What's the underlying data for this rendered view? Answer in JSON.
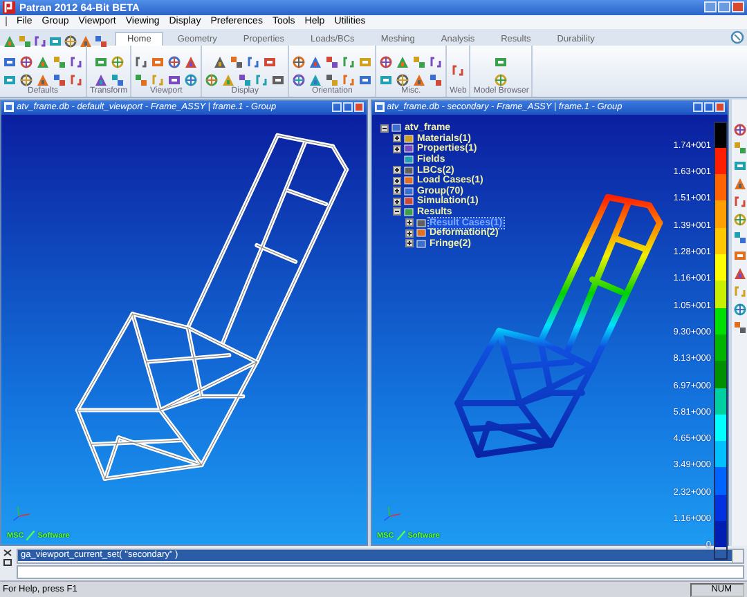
{
  "window": {
    "title": "Patran 2012 64-Bit BETA"
  },
  "menu": [
    "File",
    "Group",
    "Viewport",
    "Viewing",
    "Display",
    "Preferences",
    "Tools",
    "Help",
    "Utilities"
  ],
  "ribbon": {
    "tabs": [
      {
        "label": "Home",
        "selected": true
      },
      {
        "label": "Geometry",
        "selected": false
      },
      {
        "label": "Properties",
        "selected": false
      },
      {
        "label": "Loads/BCs",
        "selected": false
      },
      {
        "label": "Meshing",
        "selected": false
      },
      {
        "label": "Analysis",
        "selected": false
      },
      {
        "label": "Results",
        "selected": false
      },
      {
        "label": "Durability",
        "selected": false
      }
    ],
    "groups": [
      {
        "label": "Defaults"
      },
      {
        "label": "Transform"
      },
      {
        "label": "Viewport"
      },
      {
        "label": "Display"
      },
      {
        "label": "Orientation"
      },
      {
        "label": "Misc."
      },
      {
        "label": "Web"
      },
      {
        "label": "Model Browser"
      }
    ]
  },
  "viewports": [
    {
      "kind": "wireframe",
      "title": "atv_frame.db - default_viewport - Frame_ASSY | frame.1 - Group",
      "logo": [
        "MSC",
        "Software"
      ]
    },
    {
      "kind": "fringe",
      "title": "atv_frame.db - secondary - Frame_ASSY | frame.1 - Group",
      "logo": [
        "MSC",
        "Software"
      ],
      "tree": [
        {
          "label": "atv_frame",
          "expanded": true,
          "selected": false,
          "children": [
            {
              "label": "Materials(1)",
              "expanded": false,
              "selected": false
            },
            {
              "label": "Properties(1)",
              "expanded": false,
              "selected": false
            },
            {
              "label": "Fields",
              "selected": false
            },
            {
              "label": "LBCs(2)",
              "expanded": false,
              "selected": false
            },
            {
              "label": "Load Cases(1)",
              "expanded": false,
              "selected": false
            },
            {
              "label": "Group(70)",
              "expanded": false,
              "selected": false
            },
            {
              "label": "Simulation(1)",
              "expanded": false,
              "selected": false
            },
            {
              "label": "Results",
              "expanded": true,
              "selected": false,
              "children": [
                {
                  "label": "Result Cases(1)",
                  "expanded": false,
                  "selected": true
                },
                {
                  "label": "Deformation(2)",
                  "expanded": false,
                  "selected": false
                },
                {
                  "label": "Fringe(2)",
                  "expanded": false,
                  "selected": false
                }
              ]
            }
          ]
        }
      ],
      "legend": {
        "labels": [
          "1.74+001",
          "1.63+001",
          "1.51+001",
          "1.39+001",
          "1.28+001",
          "1.16+001",
          "1.05+001",
          "9.30+000",
          "8.13+000",
          "6.97+000",
          "5.81+000",
          "4.65+000",
          "3.49+000",
          "2.32+000",
          "1.16+000",
          "0"
        ],
        "segments": [
          {
            "color": "#000000"
          },
          {
            "color": "#ff1e00"
          },
          {
            "color": "#ff6400"
          },
          {
            "color": "#ffa000"
          },
          {
            "color": "#ffc800"
          },
          {
            "color": "#ffff00"
          },
          {
            "color": "#c8f000"
          },
          {
            "color": "#00e000"
          },
          {
            "color": "#00b400"
          },
          {
            "color": "#009000"
          },
          {
            "color": "#00d0a0"
          },
          {
            "color": "#00ffff"
          },
          {
            "color": "#00c0ff"
          },
          {
            "color": "#0064ff"
          },
          {
            "color": "#0032e0"
          },
          {
            "color": "#001eb4"
          }
        ]
      }
    }
  ],
  "command": {
    "history": [
      {
        "text": "ga_viewport_current_set( \"secondary\" )",
        "selected": true
      }
    ]
  },
  "status_bar": {
    "message": "For Help, press F1",
    "indicator": "NUM"
  }
}
